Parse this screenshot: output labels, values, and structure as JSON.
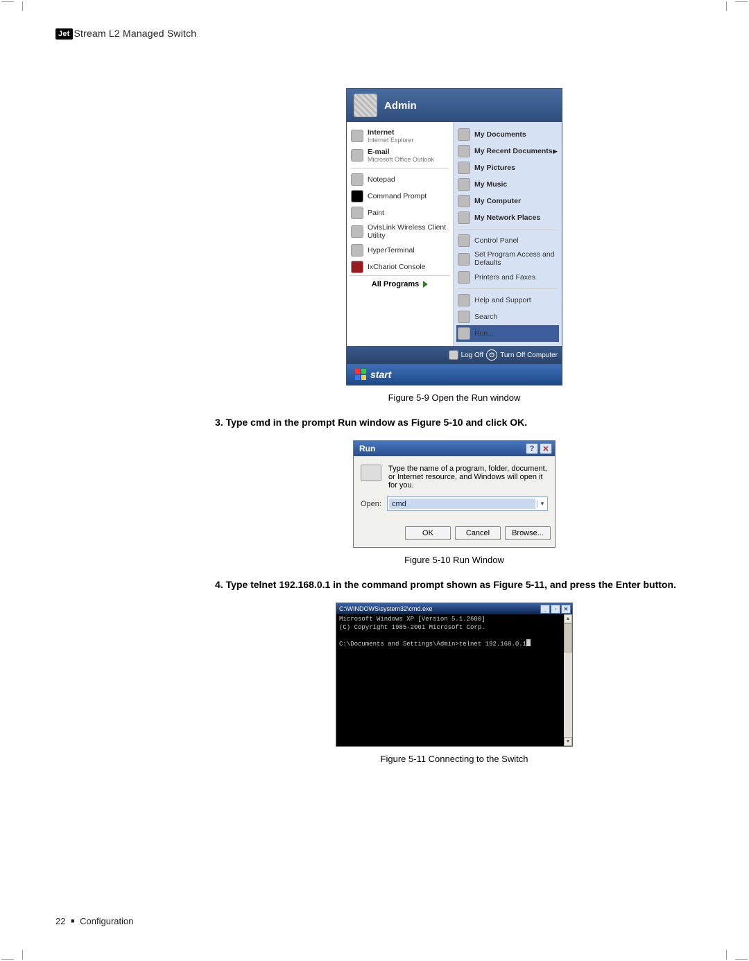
{
  "header": {
    "logo": "Jet",
    "title": "Stream L2 Managed Switch"
  },
  "startmenu": {
    "user": "Admin",
    "left_top": [
      {
        "label": "Internet",
        "sub": "Internet Explorer"
      },
      {
        "label": "E-mail",
        "sub": "Microsoft Office Outlook"
      }
    ],
    "left_items": [
      {
        "label": "Notepad"
      },
      {
        "label": "Command Prompt"
      },
      {
        "label": "Paint"
      },
      {
        "label": "OvisLink Wireless Client Utility"
      },
      {
        "label": "HyperTerminal"
      },
      {
        "label": "IxChariot Console"
      }
    ],
    "all_programs": "All Programs",
    "right_items": [
      {
        "label": "My Documents",
        "bold": true
      },
      {
        "label": "My Recent Documents",
        "bold": true,
        "arrow": true
      },
      {
        "label": "My Pictures",
        "bold": true
      },
      {
        "label": "My Music",
        "bold": true
      },
      {
        "label": "My Computer",
        "bold": true
      },
      {
        "label": "My Network Places",
        "bold": true
      },
      {
        "sep": true
      },
      {
        "label": "Control Panel"
      },
      {
        "label": "Set Program Access and Defaults"
      },
      {
        "label": "Printers and Faxes"
      },
      {
        "sep": true
      },
      {
        "label": "Help and Support"
      },
      {
        "label": "Search"
      },
      {
        "label": "Run...",
        "highlight": true
      }
    ],
    "logoff": "Log Off",
    "turnoff": "Turn Off Computer",
    "start": "start"
  },
  "captions": {
    "fig59": "Figure 5-9  Open the Run window",
    "fig510": "Figure 5-10  Run Window",
    "fig511": "Figure 5-11  Connecting to the Switch"
  },
  "steps": {
    "s3": "3. Type cmd in the prompt Run window as Figure 5-10 and click OK.",
    "s4": "4. Type telnet 192.168.0.1 in the command prompt shown as Figure 5-11, and press the Enter button."
  },
  "run": {
    "title": "Run",
    "desc": "Type the name of a program, folder, document, or Internet resource, and Windows will open it for you.",
    "open_label": "Open:",
    "value": "cmd",
    "ok": "OK",
    "cancel": "Cancel",
    "browse": "Browse..."
  },
  "cmd": {
    "title": "C:\\WINDOWS\\system32\\cmd.exe",
    "line1": "Microsoft Windows XP [Version 5.1.2600]",
    "line2": "(C) Copyright 1985-2001 Microsoft Corp.",
    "line3": "C:\\Documents and Settings\\Admin>telnet 192.168.0.1"
  },
  "footer": {
    "page": "22",
    "section": "Configuration"
  }
}
